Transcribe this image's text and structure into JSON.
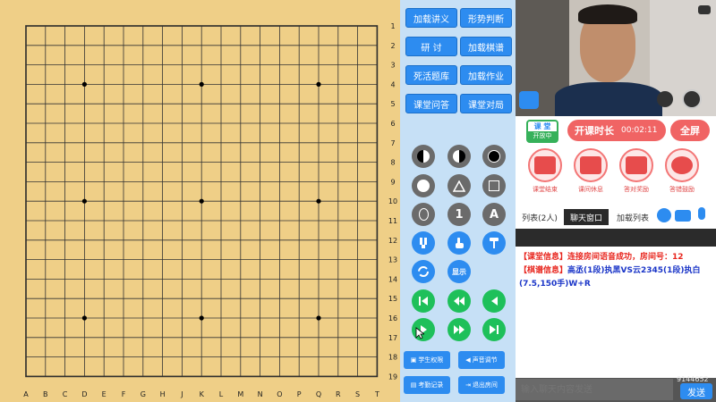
{
  "board": {
    "col_labels": [
      "A",
      "B",
      "C",
      "D",
      "E",
      "F",
      "G",
      "H",
      "J",
      "K",
      "L",
      "M",
      "N",
      "O",
      "P",
      "Q",
      "R",
      "S",
      "T"
    ],
    "row_labels": [
      "1",
      "2",
      "3",
      "4",
      "5",
      "6",
      "7",
      "8",
      "9",
      "10",
      "11",
      "12",
      "13",
      "14",
      "15",
      "16",
      "17",
      "18",
      "19"
    ]
  },
  "top_buttons": {
    "load_lecture": "加载讲义",
    "situation_judge": "形势判断",
    "discuss": "研 讨",
    "load_record": "加载棋谱",
    "life_death": "死活题库",
    "load_homework": "加载作业",
    "class_qa": "课堂问答",
    "class_game": "课堂对局"
  },
  "tools": {
    "show_label": "显示",
    "letter_a": "A",
    "number_1": "1"
  },
  "bottom_buttons": {
    "student_permission": "学生权限",
    "sound_adjust": "声音调节",
    "attendance": "考勤记录",
    "exit_room": "退出房间"
  },
  "class_panel": {
    "badge_top": "课 堂",
    "badge_bottom": "开放中",
    "duration_label": "开课时长",
    "duration_value": "00:02:11",
    "fullscreen": "全屏",
    "actions": [
      "课堂结束",
      "课间休息",
      "答对奖励",
      "答错鼓励"
    ]
  },
  "chat": {
    "tabs": [
      "列表(2人)",
      "聊天窗口",
      "加载列表"
    ],
    "messages": [
      {
        "tag": "【课堂信息】",
        "text": "连接房间语音成功，房间号：12"
      },
      {
        "tag": "【棋谱信息】",
        "text": "高丞(1段)执黑VS云2345(1段)执白(7.5,150手)W+R"
      }
    ],
    "input_placeholder": "输入聊天内容发送",
    "send": "发送",
    "overlay_id": "9144652"
  }
}
